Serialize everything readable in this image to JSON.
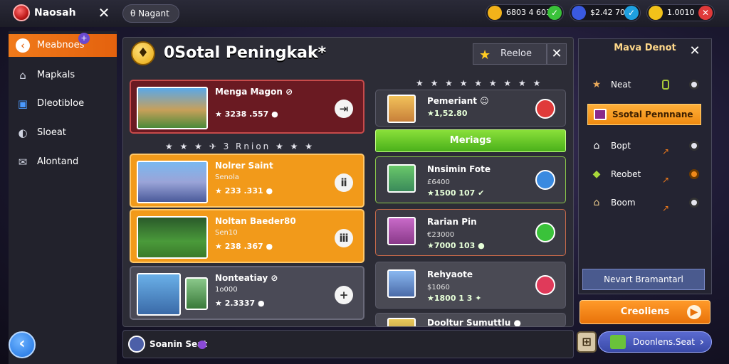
{
  "topbar": {
    "app_title": "Naosah",
    "nav_pill": "θ Nagant",
    "resources": [
      {
        "value": "6803 4 603",
        "color": "#f2b21a",
        "plus_color": "#3ac23a"
      },
      {
        "value": "$2.42 70",
        "color": "#3a5ae0",
        "plus_color": "#1ea0e0"
      },
      {
        "value": "1.0010",
        "color": "#f2c21a",
        "plus_color": "#e03a3a"
      }
    ]
  },
  "sidebar": {
    "items": [
      {
        "label": "Meabnoes",
        "icon": "‹",
        "active": true
      },
      {
        "label": "Mapkals",
        "icon": "⌂",
        "active": false
      },
      {
        "label": "Dleotibloe",
        "icon": "▣",
        "active": false
      },
      {
        "label": "Sloeat",
        "icon": "◐",
        "active": false
      },
      {
        "label": "Alontand",
        "icon": "✉",
        "active": false
      }
    ]
  },
  "main": {
    "title": "0Sotal Peningkak*",
    "header_button": "Reeloe",
    "divider_left": "★ ★ ★ ✈ 3 Rnion ★ ★ ★",
    "divider_right": "★ ★ ★ ★ ★ ★ ★ ★ ★",
    "left_cards": [
      {
        "name": "Menga Magon ⊘",
        "sub": "",
        "score": "★ 3238 .557 ●",
        "bg": "#6a1a22",
        "action": "⇥"
      },
      {
        "name": "Nolrer Saint",
        "sub": "Senola",
        "score": "★ 233 .331 ●",
        "bg": "#f29a1a",
        "action": "ⅱ"
      },
      {
        "name": "Noltan Baeder80",
        "sub": "Sen10",
        "score": "★ 238 .367 ●",
        "bg": "#f29a1a",
        "action": "ⅲ"
      },
      {
        "name": "Nonteatiay ⊘",
        "sub": "1o000",
        "score": "★ 2.3337 ●",
        "bg": "#4a4a56",
        "action": "+"
      }
    ],
    "right_cards": [
      {
        "name": "Pemeriant ☺",
        "sub": "",
        "score": "★1,52.80",
        "bg": "#3a3a44",
        "ring": "#e03a3a"
      },
      {
        "name": "Nnsimin Fote",
        "sub": "£6400",
        "score": "★1500  107 ✔",
        "bg": "#3a3a44",
        "ring": "#3a8ae0"
      },
      {
        "name": "Rarian Pin",
        "sub": "€23000",
        "score": "★7000  103 ●",
        "bg": "#3a3a44",
        "ring": "#3ac23a"
      },
      {
        "name": "Rehyaote",
        "sub": "$1060",
        "score": "★1800  1 3 ✦",
        "bg": "#3a3a44",
        "ring": "#e03a5a"
      },
      {
        "name": "Dooltur Sumuttlu ●",
        "sub": "",
        "score": "",
        "bg": "#3a3a44",
        "ring": "#e03a3a"
      }
    ],
    "green_button": "Meriags"
  },
  "right_panel": {
    "title": "Mava Denot",
    "rows": [
      {
        "label": "Neat",
        "icon": "★"
      },
      {
        "label": "Bopt",
        "icon": "⌂"
      },
      {
        "label": "Reobet",
        "icon": "◆"
      },
      {
        "label": "Boom",
        "icon": "⌂"
      }
    ],
    "active_label": "Ssotal Pennnane",
    "bottom_button": "Nevart Bramantarl",
    "cta": "Creoliens"
  },
  "bottom": {
    "label": "Soanin Seat",
    "pill_label": "Doonlens.Seat"
  }
}
